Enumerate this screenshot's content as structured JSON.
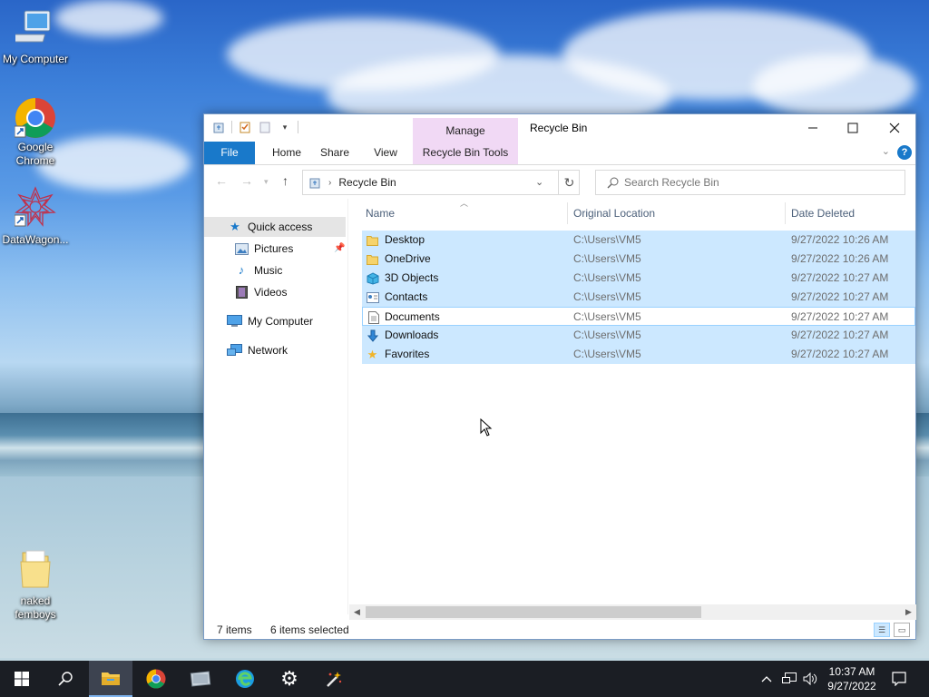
{
  "desktop": {
    "icons": [
      {
        "label": "My Computer",
        "icon": "computer-icon"
      },
      {
        "label": "Google Chrome",
        "icon": "chrome-icon"
      },
      {
        "label": "DataWagon...",
        "icon": "datawagon-icon"
      },
      {
        "label": "naked femboys",
        "icon": "folder-icon"
      }
    ]
  },
  "window": {
    "title": "Recycle Bin",
    "manage_tab": "Manage",
    "ribbon": {
      "file": "File",
      "home": "Home",
      "share": "Share",
      "view": "View",
      "tools": "Recycle Bin Tools"
    },
    "address": {
      "path": "Recycle Bin",
      "search_placeholder": "Search Recycle Bin"
    },
    "nav": {
      "quick_access": "Quick access",
      "pictures": "Pictures",
      "music": "Music",
      "videos": "Videos",
      "my_computer": "My Computer",
      "network": "Network"
    },
    "columns": {
      "name": "Name",
      "original_location": "Original Location",
      "date_deleted": "Date Deleted"
    },
    "files": [
      {
        "name": "Desktop",
        "location": "C:\\Users\\VM5",
        "date": "9/27/2022 10:26 AM",
        "icon": "folder-icon",
        "selected": true
      },
      {
        "name": "OneDrive",
        "location": "C:\\Users\\VM5",
        "date": "9/27/2022 10:26 AM",
        "icon": "folder-icon",
        "selected": true
      },
      {
        "name": "3D Objects",
        "location": "C:\\Users\\VM5",
        "date": "9/27/2022 10:27 AM",
        "icon": "cube-icon",
        "selected": true
      },
      {
        "name": "Contacts",
        "location": "C:\\Users\\VM5",
        "date": "9/27/2022 10:27 AM",
        "icon": "contact-card-icon",
        "selected": true
      },
      {
        "name": "Documents",
        "location": "C:\\Users\\VM5",
        "date": "9/27/2022 10:27 AM",
        "icon": "document-icon",
        "selected": false
      },
      {
        "name": "Downloads",
        "location": "C:\\Users\\VM5",
        "date": "9/27/2022 10:27 AM",
        "icon": "download-arrow-icon",
        "selected": true
      },
      {
        "name": "Favorites",
        "location": "C:\\Users\\VM5",
        "date": "9/27/2022 10:27 AM",
        "icon": "star-icon",
        "selected": true
      }
    ],
    "status": {
      "count": "7 items",
      "selected": "6 items selected"
    }
  },
  "taskbar": {
    "time": "10:37 AM",
    "date": "9/27/2022"
  },
  "colors": {
    "accent": "#1979ca",
    "selection": "#cce8ff",
    "manage_tab": "#f1d9f5"
  }
}
